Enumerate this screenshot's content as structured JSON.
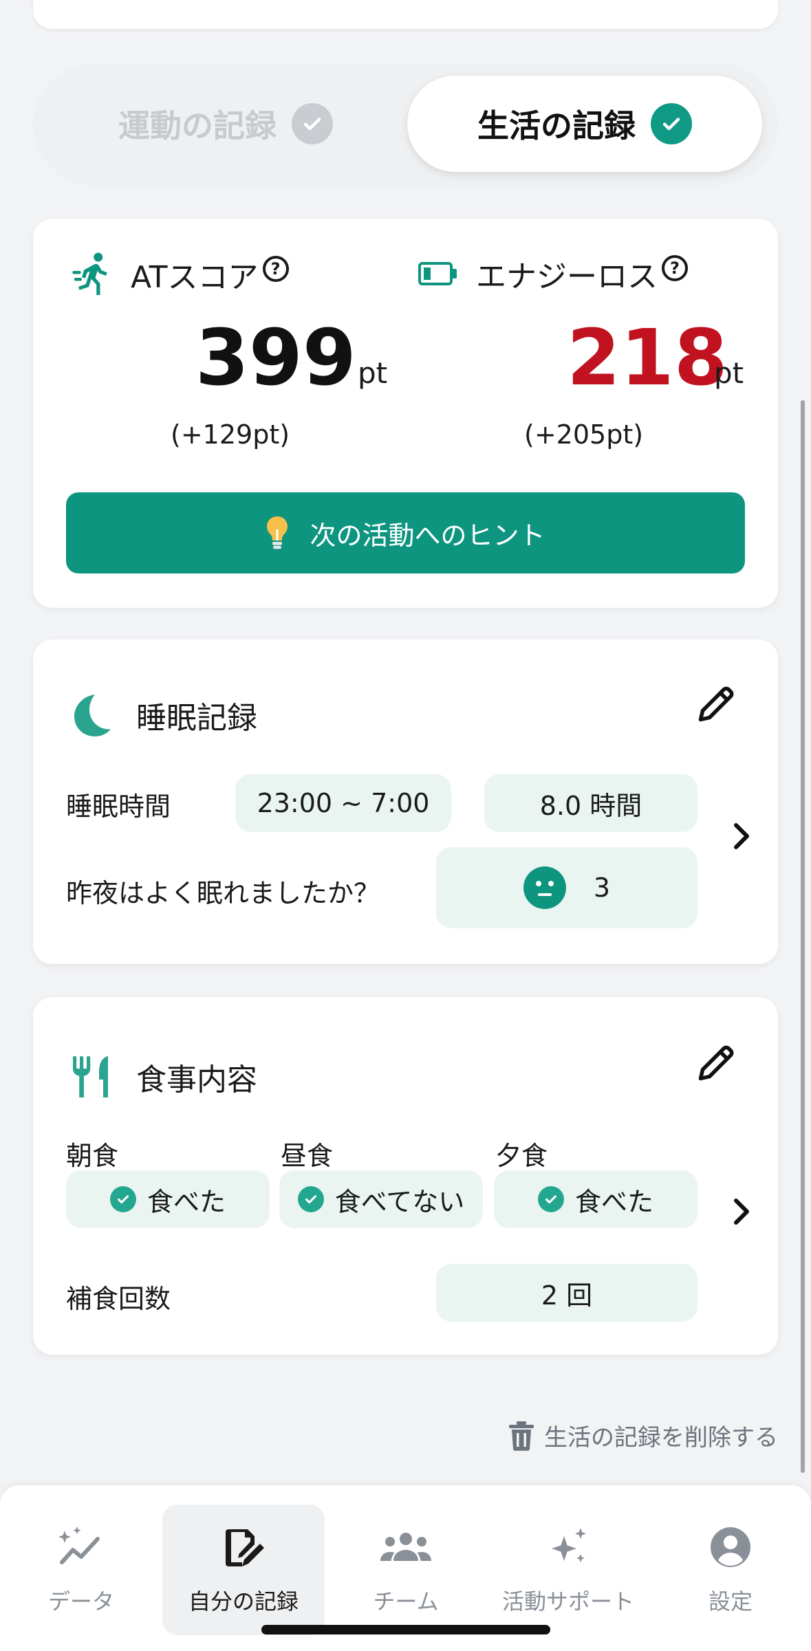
{
  "tabs": {
    "exercise": "運動の記録",
    "life": "生活の記録"
  },
  "scores": {
    "at": {
      "label": "ATスコア",
      "value": "399",
      "unit": "pt",
      "delta": "(+129pt)"
    },
    "energy": {
      "label": "エナジーロス",
      "value": "218",
      "unit": "pt",
      "delta": "(+205pt)"
    },
    "hint_button": "次の活動へのヒント"
  },
  "sleep": {
    "title": "睡眠記録",
    "time_label": "睡眠時間",
    "time_range": "23:00 ~ 7:00",
    "duration": "8.0 時間",
    "quality_question": "昨夜はよく眠れましたか？",
    "quality_value": "3"
  },
  "meal": {
    "title": "食事内容",
    "breakfast_label": "朝食",
    "lunch_label": "昼食",
    "dinner_label": "夕食",
    "breakfast_value": "食べた",
    "lunch_value": "食べてない",
    "dinner_value": "食べた",
    "snack_label": "補食回数",
    "snack_value": "2 回"
  },
  "delete_label": "生活の記録を削除する",
  "nav": [
    {
      "label": "データ",
      "icon": "trend-sparkle-icon"
    },
    {
      "label": "自分の記録",
      "icon": "edit-record-icon"
    },
    {
      "label": "チーム",
      "icon": "team-icon"
    },
    {
      "label": "活動サポート",
      "icon": "sparkles-icon"
    },
    {
      "label": "設定",
      "icon": "account-circle-icon"
    }
  ],
  "colors": {
    "accent": "#0e9580",
    "energy_red": "#c1121f",
    "pill_bg": "#eaf5f2",
    "muted": "#8a9098"
  }
}
